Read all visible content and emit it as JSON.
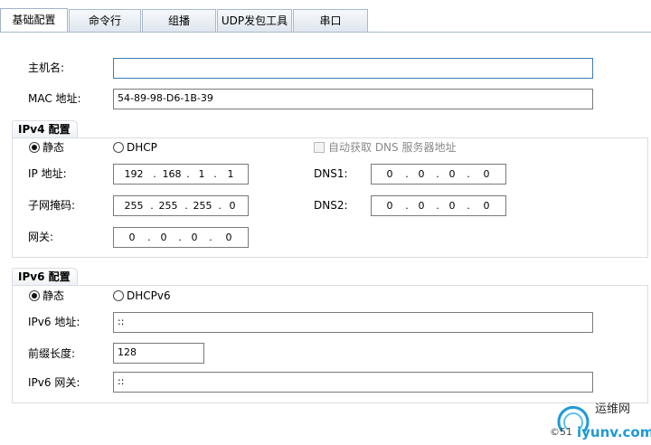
{
  "tabs": [
    {
      "label": "基础配置",
      "active": true
    },
    {
      "label": "命令行"
    },
    {
      "label": "组播"
    },
    {
      "label": "UDP发包工具"
    },
    {
      "label": "串口"
    }
  ],
  "basic": {
    "hostname_label": "主机名:",
    "hostname_value": "",
    "mac_label": "MAC 地址:",
    "mac_value": "54-89-98-D6-1B-39"
  },
  "ipv4": {
    "legend": "IPv4 配置",
    "static_label": "静态",
    "dhcp_label": "DHCP",
    "auto_dns_label": "自动获取 DNS 服务器地址",
    "ip_label": "IP 地址:",
    "ip": [
      "192",
      "168",
      "1",
      "1"
    ],
    "mask_label": "子网掩码:",
    "mask": [
      "255",
      "255",
      "255",
      "0"
    ],
    "gw_label": "网关:",
    "gw": [
      "0",
      "0",
      "0",
      "0"
    ],
    "dns1_label": "DNS1:",
    "dns1": [
      "0",
      "0",
      "0",
      "0"
    ],
    "dns2_label": "DNS2:",
    "dns2": [
      "0",
      "0",
      "0",
      "0"
    ],
    "dot": "."
  },
  "ipv6": {
    "legend": "IPv6 配置",
    "static_label": "静态",
    "dhcp_label": "DHCPv6",
    "addr_label": "IPv6 地址:",
    "addr_value": "::",
    "prefix_label": "前缀长度:",
    "prefix_value": "128",
    "gw_label": "IPv6 网关:",
    "gw_value": "::"
  },
  "watermark": {
    "text_cn": "运维网",
    "text_url": "iyunv.com",
    "prefix": "©51"
  }
}
